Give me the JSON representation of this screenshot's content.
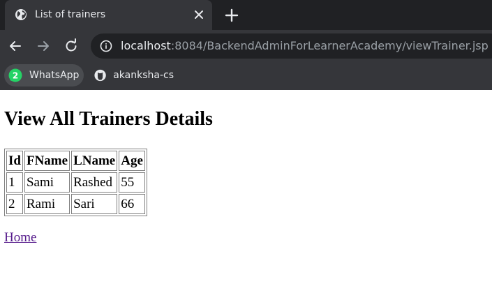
{
  "browser": {
    "tab": {
      "title": "List of trainers",
      "favicon": "globe-icon"
    },
    "new_tab_icon": "plus-icon",
    "close_icon": "close-icon",
    "nav": {
      "back_icon": "arrow-left-icon",
      "forward_icon": "arrow-right-icon",
      "reload_icon": "reload-icon"
    },
    "address": {
      "host": "localhost",
      "path": ":8084/BackendAdminForLearnerAcademy/viewTrainer.jsp",
      "info_icon": "info-icon"
    },
    "bookmarks": [
      {
        "label": "WhatsApp",
        "icon": "whatsapp-icon",
        "badge": "2"
      },
      {
        "label": "akanksha-cs",
        "icon": "github-icon"
      }
    ]
  },
  "page": {
    "heading": "View All Trainers Details",
    "table": {
      "headers": [
        "Id",
        "FName",
        "LName",
        "Age"
      ],
      "rows": [
        [
          "1",
          "Sami",
          "Rashed",
          "55"
        ],
        [
          "2",
          "Rami",
          "Sari",
          "66"
        ]
      ]
    },
    "home_link": "Home"
  },
  "colors": {
    "tabstrip": "#202124",
    "toolbar": "#35363a",
    "link_visited": "#551a8b"
  }
}
